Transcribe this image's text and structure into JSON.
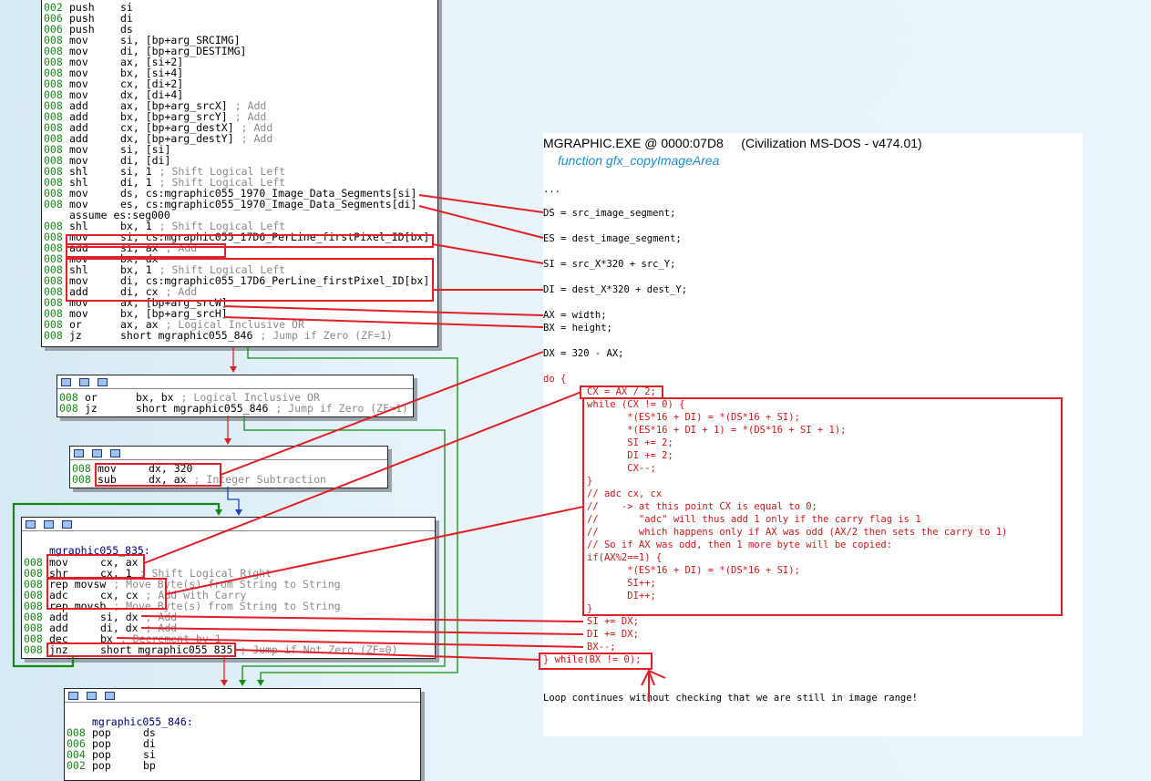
{
  "colors": {
    "accent_red": "#e01f26",
    "green_edge": "#138a13",
    "blue_edge": "#1f3fd0",
    "function_name": "#1c8fd6"
  },
  "block1": {
    "lines": [
      {
        "addr": "002",
        "op": "push",
        "args": "si",
        "comment": ""
      },
      {
        "addr": "006",
        "op": "push",
        "args": "di",
        "comment": ""
      },
      {
        "addr": "006",
        "op": "push",
        "args": "ds",
        "comment": ""
      },
      {
        "addr": "008",
        "op": "mov",
        "args": "si, [bp+arg_SRCIMG]",
        "comment": ""
      },
      {
        "addr": "008",
        "op": "mov",
        "args": "di, [bp+arg_DESTIMG]",
        "comment": ""
      },
      {
        "addr": "008",
        "op": "mov",
        "args": "ax, [si+2]",
        "comment": ""
      },
      {
        "addr": "008",
        "op": "mov",
        "args": "bx, [si+4]",
        "comment": ""
      },
      {
        "addr": "008",
        "op": "mov",
        "args": "cx, [di+2]",
        "comment": ""
      },
      {
        "addr": "008",
        "op": "mov",
        "args": "dx, [di+4]",
        "comment": ""
      },
      {
        "addr": "008",
        "op": "add",
        "args": "ax, [bp+arg_srcX]",
        "comment": "; Add"
      },
      {
        "addr": "008",
        "op": "add",
        "args": "bx, [bp+arg_srcY]",
        "comment": "; Add"
      },
      {
        "addr": "008",
        "op": "add",
        "args": "cx, [bp+arg_destX]",
        "comment": "; Add"
      },
      {
        "addr": "008",
        "op": "add",
        "args": "dx, [bp+arg_destY]",
        "comment": "; Add"
      },
      {
        "addr": "008",
        "op": "mov",
        "args": "si, [si]",
        "comment": ""
      },
      {
        "addr": "008",
        "op": "mov",
        "args": "di, [di]",
        "comment": ""
      },
      {
        "addr": "008",
        "op": "shl",
        "args": "si, 1",
        "comment": "; Shift Logical Left"
      },
      {
        "addr": "008",
        "op": "shl",
        "args": "di, 1",
        "comment": "; Shift Logical Left"
      },
      {
        "addr": "008",
        "op": "mov",
        "args": "ds, cs:mgraphic055_1970_Image_Data_Segments[si]",
        "comment": ""
      },
      {
        "addr": "008",
        "op": "mov",
        "args": "es, cs:mgraphic055_1970_Image_Data_Segments[di]",
        "comment": ""
      },
      {
        "addr": "",
        "op": "assume es:seg000",
        "args": "",
        "comment": ""
      },
      {
        "addr": "008",
        "op": "shl",
        "args": "bx, 1",
        "comment": "; Shift Logical Left"
      },
      {
        "addr": "008",
        "op": "mov",
        "args": "si, cs:mgraphic055_17D6_PerLine_firstPixel_ID[bx]",
        "comment": ""
      },
      {
        "addr": "008",
        "op": "add",
        "args": "si, ax",
        "comment": "; Add"
      },
      {
        "addr": "008",
        "op": "mov",
        "args": "bx, dx",
        "comment": ""
      },
      {
        "addr": "008",
        "op": "shl",
        "args": "bx, 1",
        "comment": "; Shift Logical Left"
      },
      {
        "addr": "008",
        "op": "mov",
        "args": "di, cs:mgraphic055_17D6_PerLine_firstPixel_ID[bx]",
        "comment": ""
      },
      {
        "addr": "008",
        "op": "add",
        "args": "di, cx",
        "comment": "; Add"
      },
      {
        "addr": "008",
        "op": "mov",
        "args": "ax, [bp+arg_srcW]",
        "comment": ""
      },
      {
        "addr": "008",
        "op": "mov",
        "args": "bx, [bp+arg_srcH]",
        "comment": ""
      },
      {
        "addr": "008",
        "op": "or",
        "args": "ax, ax",
        "comment": "; Logical Inclusive OR"
      },
      {
        "addr": "008",
        "op": "jz",
        "args": "short mgraphic055_846",
        "comment": "; Jump if Zero (ZF=1)"
      }
    ]
  },
  "block2": {
    "lines": [
      {
        "addr": "008",
        "op": "or",
        "args": "bx, bx",
        "comment": "; Logical Inclusive OR"
      },
      {
        "addr": "008",
        "op": "jz",
        "args": "short mgraphic055_846",
        "comment": "; Jump if Zero (ZF=1)"
      }
    ]
  },
  "block3": {
    "lines": [
      {
        "addr": "008",
        "op": "mov",
        "args": "dx, 320",
        "comment": ""
      },
      {
        "addr": "008",
        "op": "sub",
        "args": "dx, ax",
        "comment": "; Integer Subtraction"
      }
    ]
  },
  "block4": {
    "label": "mgraphic055_835:",
    "lines": [
      {
        "addr": "008",
        "op": "mov",
        "args": "cx, ax",
        "comment": ""
      },
      {
        "addr": "008",
        "op": "shr",
        "args": "cx, 1",
        "comment": "; Shift Logical Right"
      },
      {
        "addr": "008",
        "op": "rep movsw",
        "args": "",
        "comment": "; Move Byte(s) from String to String"
      },
      {
        "addr": "008",
        "op": "adc",
        "args": "cx, cx",
        "comment": "; Add with Carry"
      },
      {
        "addr": "008",
        "op": "rep movsb",
        "args": "",
        "comment": "; Move Byte(s) from String to String"
      },
      {
        "addr": "008",
        "op": "add",
        "args": "si, dx",
        "comment": "; Add"
      },
      {
        "addr": "008",
        "op": "add",
        "args": "di, dx",
        "comment": "; Add"
      },
      {
        "addr": "008",
        "op": "dec",
        "args": "bx",
        "comment": "; Decrement by 1"
      },
      {
        "addr": "008",
        "op": "jnz",
        "args": "short mgraphic055_835",
        "comment": "; Jump if Not Zero (ZF=0)"
      }
    ]
  },
  "block5": {
    "label": "mgraphic055_846:",
    "lines": [
      {
        "addr": "008",
        "op": "pop",
        "args": "ds",
        "comment": ""
      },
      {
        "addr": "006",
        "op": "pop",
        "args": "di",
        "comment": ""
      },
      {
        "addr": "004",
        "op": "pop",
        "args": "si",
        "comment": ""
      },
      {
        "addr": "002",
        "op": "pop",
        "args": "bp",
        "comment": ""
      }
    ]
  },
  "notes": {
    "title": "MGRAPHIC.EXE @ 0000:07D8     (Civilization MS-DOS - v474.01)",
    "function_name": "function gfx_copyImageArea",
    "ellipsis": "...",
    "ds": "DS = src_image_segment;",
    "es": "ES = dest_image_segment;",
    "si": "SI = src_X*320 + src_Y;",
    "di": "DI = dest_X*320 + dest_Y;",
    "ax": "AX = width;",
    "bx": "BX = height;",
    "dx": "DX = 320 - AX;",
    "do": "do {",
    "cx_half": "CX = AX / 2;",
    "loop": [
      "while (CX != 0) {",
      "       *(ES*16 + DI) = *(DS*16 + SI);",
      "       *(ES*16 + DI + 1) = *(DS*16 + SI + 1);",
      "       SI += 2;",
      "       DI += 2;",
      "       CX--;",
      "}",
      "// adc cx, cx",
      "//    -> at this point CX is equal to 0;",
      "//       \"adc\" will thus add 1 only if the carry flag is 1",
      "//       which happens only if AX was odd (AX/2 then sets the carry to 1)",
      "// So if AX was odd, then 1 more byte will be copied:",
      "if(AX%2==1) {",
      "       *(ES*16 + DI) = *(DS*16 + SI);",
      "       SI++;",
      "       DI++;",
      "}"
    ],
    "si_dx": "SI += DX;",
    "di_dx": "DI += DX;",
    "bx_dec": "BX--;",
    "while_end": "} while(BX != 0);",
    "footer": "Loop continues without checking that we are still in image range!"
  }
}
